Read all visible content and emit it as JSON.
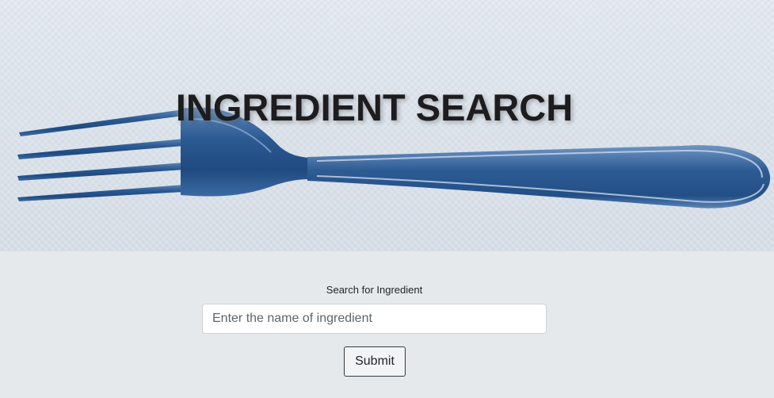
{
  "hero": {
    "title": "INGREDIENT SEARCH",
    "image": "fork-image"
  },
  "search": {
    "label": "Search for Ingredient",
    "placeholder": "Enter the name of ingredient",
    "value": "",
    "submit_label": "Submit"
  },
  "colors": {
    "background": "#e5e9ec",
    "hero_background": "#dbe2ea",
    "fork_blue": "#2f5f9a",
    "title": "#1d1d1f"
  }
}
